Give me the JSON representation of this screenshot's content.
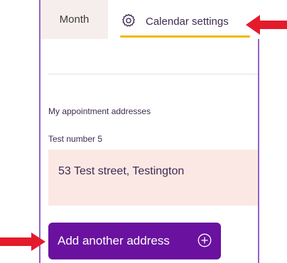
{
  "tabs": {
    "month_label": "Month",
    "settings_label": "Calendar settings",
    "settings_icon": "gear-icon"
  },
  "addresses": {
    "section_title": "My appointment addresses",
    "items": [
      {
        "name": "Test number 5",
        "address": "53 Test street, Testington"
      }
    ]
  },
  "add_button": {
    "label": "Add another address",
    "icon": "plus-circle-icon"
  },
  "colors": {
    "accent_purple": "#6a129f",
    "tab_underline": "#f1b800",
    "annotation_arrow": "#e41b2b"
  }
}
